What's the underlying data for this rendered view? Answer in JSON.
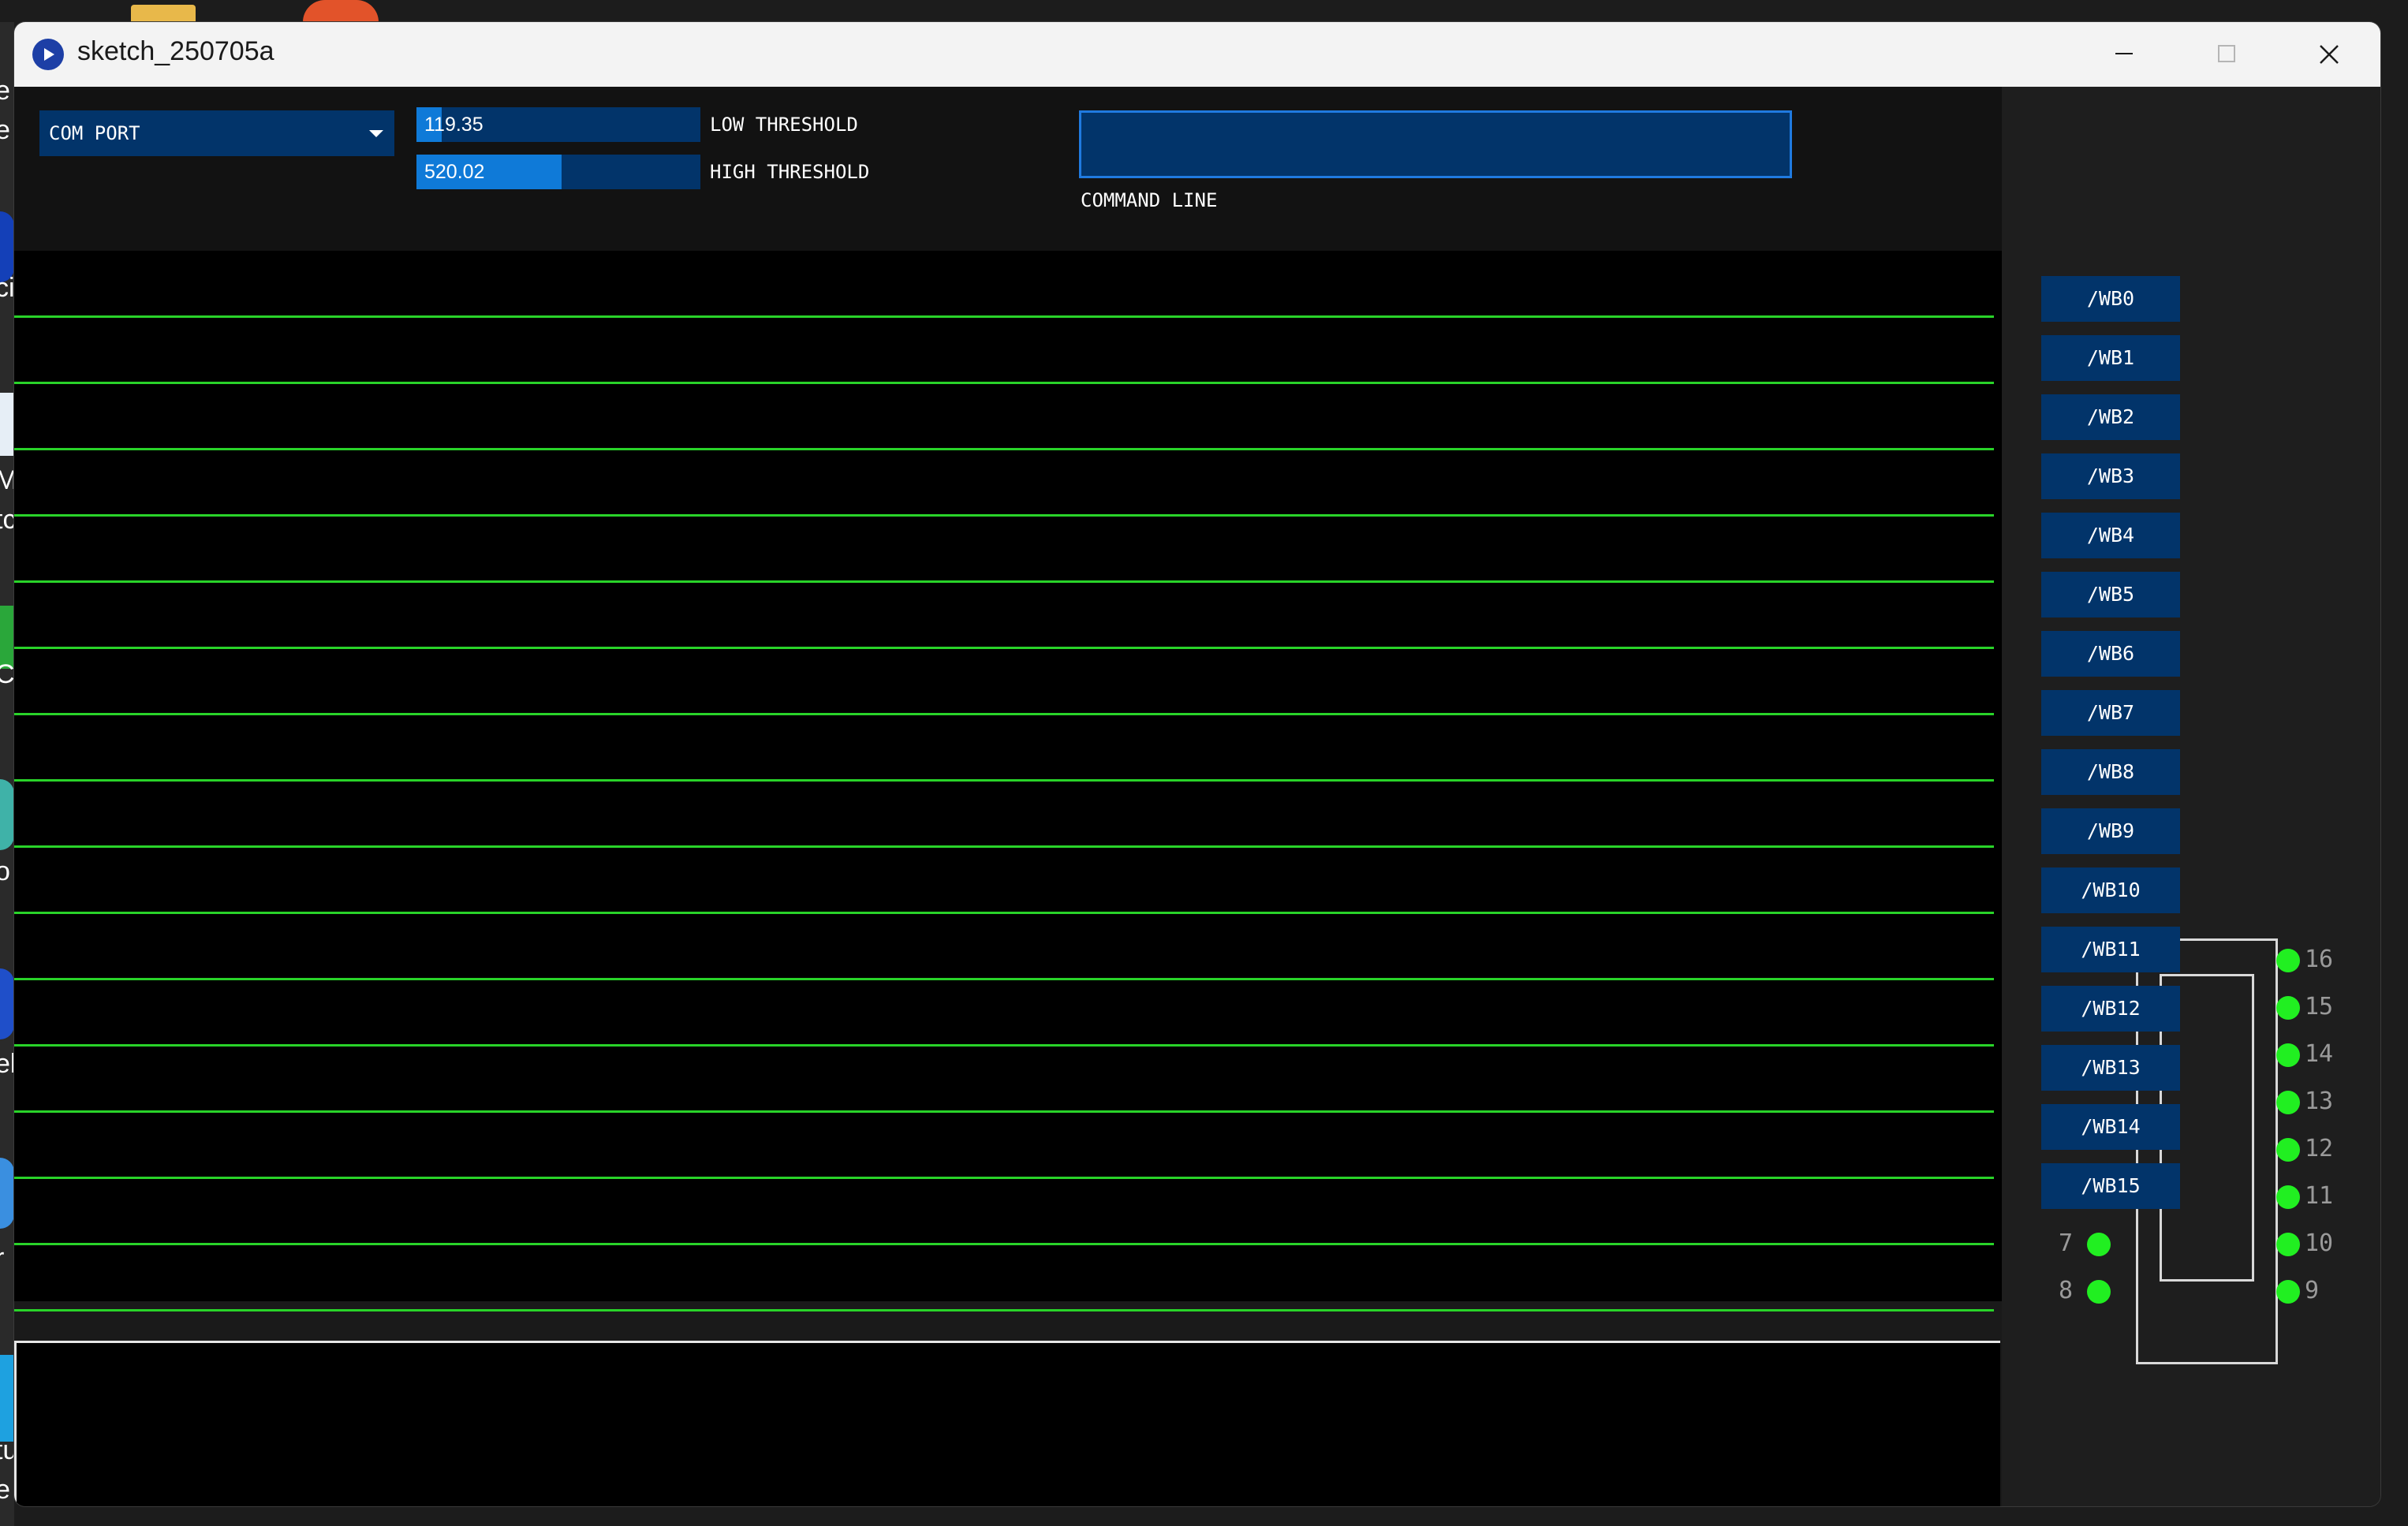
{
  "window": {
    "title": "sketch_250705a"
  },
  "controls": {
    "com_port_label": "COM PORT",
    "low_threshold": {
      "value": "119.35",
      "label": "LOW THRESHOLD",
      "fill_fraction": 0.09
    },
    "high_threshold": {
      "value": "520.02",
      "label": "HIGH THRESHOLD",
      "fill_fraction": 0.51
    },
    "command_line": {
      "value": "",
      "label": "COMMAND LINE"
    }
  },
  "plot": {
    "line_count": 16,
    "line_color": "#29d329"
  },
  "wb_buttons": [
    "/WB0",
    "/WB1",
    "/WB2",
    "/WB3",
    "/WB4",
    "/WB5",
    "/WB6",
    "/WB7",
    "/WB8",
    "/WB9",
    "/WB10",
    "/WB11",
    "/WB12",
    "/WB13",
    "/WB14",
    "/WB15"
  ],
  "chip": {
    "left_pins": [
      "7",
      "8"
    ],
    "right_pins": [
      "16",
      "15",
      "14",
      "13",
      "12",
      "11",
      "10",
      "9"
    ],
    "led_color": "#21ef21"
  },
  "desktop": {
    "fragments": [
      "e",
      "e",
      "ci",
      "Ma",
      "tc",
      "C",
      "o",
      "eb",
      "r",
      "tu",
      "e"
    ]
  },
  "colors": {
    "panel_blue": "#02346a",
    "slider_fill": "#0f7ad8",
    "accent_border": "#1f7ae0"
  }
}
